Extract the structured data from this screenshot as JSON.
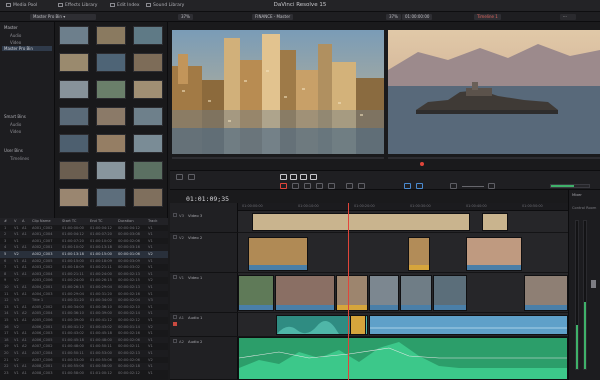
{
  "window": {
    "title": "DaVinci Resolve 15"
  },
  "top_tabs": [
    {
      "label": "Media Pool",
      "icon": "media-pool-icon"
    },
    {
      "label": "Effects Library",
      "icon": "effects-icon"
    },
    {
      "label": "Edit Index",
      "icon": "list-icon"
    },
    {
      "label": "Sound Library",
      "icon": "sound-library-icon"
    }
  ],
  "subbar": {
    "bin_select": "Master Pro Bin",
    "zoom_left": "37%",
    "source_name": "FINANCE - Master",
    "zoom_right": "37%",
    "timecode_display": "01:00:00:00",
    "timeline_name": "Timeline 1"
  },
  "bins": {
    "root": "Master",
    "items": [
      "Audio",
      "Master Pro Bin",
      "Video"
    ],
    "selected": "Master Pro Bin",
    "smart_bins_header": "Smart Bins",
    "smart_bins": [
      "Audio",
      "Video"
    ],
    "user_bins_header": "User Bins",
    "user_bins": [
      "Timelines"
    ]
  },
  "clip_list": {
    "columns": [
      "#",
      "V",
      "A",
      "Clip Name",
      "Start TC",
      "End TC",
      "Duration",
      "Track"
    ],
    "rows": [
      [
        "1",
        "V1",
        "A1",
        "A001_C002",
        "01:00:00:00",
        "01:00:04:12",
        "00:00:04:12",
        "V1"
      ],
      [
        "2",
        "V1",
        "A1",
        "A001_C004",
        "01:00:04:12",
        "01:00:07:20",
        "00:00:03:08",
        "V1"
      ],
      [
        "3",
        "V1",
        "",
        "A001_C007",
        "01:00:07:20",
        "01:00:10:02",
        "00:00:02:06",
        "V1"
      ],
      [
        "4",
        "V1",
        "A1",
        "A002_C001",
        "01:00:10:02",
        "01:00:13:18",
        "00:00:03:16",
        "V1"
      ],
      [
        "5",
        "V2",
        "",
        "A002_C003",
        "01:00:13:18",
        "01:00:15:00",
        "00:00:01:06",
        "V2"
      ],
      [
        "6",
        "V1",
        "A1",
        "A002_C005",
        "01:00:15:00",
        "01:00:18:09",
        "00:00:03:09",
        "V1"
      ],
      [
        "7",
        "V1",
        "A1",
        "A003_C002",
        "01:00:18:09",
        "01:00:21:11",
        "00:00:03:02",
        "V1"
      ],
      [
        "8",
        "V1",
        "A1",
        "A003_C004",
        "01:00:21:11",
        "01:00:24:00",
        "00:00:02:13",
        "V1"
      ],
      [
        "9",
        "V2",
        "",
        "A003_C006",
        "01:00:24:00",
        "01:00:26:15",
        "00:00:02:15",
        "V2"
      ],
      [
        "10",
        "V1",
        "A1",
        "A004_C001",
        "01:00:26:15",
        "01:00:29:04",
        "00:00:02:13",
        "V1"
      ],
      [
        "11",
        "V1",
        "A1",
        "A004_C003",
        "01:00:29:04",
        "01:00:31:20",
        "00:00:02:16",
        "V1"
      ],
      [
        "12",
        "V3",
        "",
        "Title 1",
        "01:00:31:20",
        "01:00:34:00",
        "00:00:02:04",
        "V3"
      ],
      [
        "13",
        "V1",
        "A1",
        "A005_C002",
        "01:00:34:00",
        "01:00:36:10",
        "00:00:02:10",
        "V1"
      ],
      [
        "14",
        "V1",
        "A2",
        "A005_C004",
        "01:00:36:10",
        "01:00:39:00",
        "00:00:02:14",
        "V1"
      ],
      [
        "15",
        "V1",
        "A1",
        "A005_C006",
        "01:00:39:00",
        "01:00:41:12",
        "00:00:02:12",
        "V1"
      ],
      [
        "16",
        "V2",
        "",
        "A006_C001",
        "01:00:41:12",
        "01:00:43:02",
        "00:00:01:14",
        "V2"
      ],
      [
        "17",
        "V1",
        "A1",
        "A006_C003",
        "01:00:43:02",
        "01:00:45:18",
        "00:00:02:16",
        "V1"
      ],
      [
        "18",
        "V1",
        "A1",
        "A006_C005",
        "01:00:45:18",
        "01:00:48:00",
        "00:00:02:06",
        "V1"
      ],
      [
        "19",
        "V1",
        "A2",
        "A007_C002",
        "01:00:48:00",
        "01:00:50:11",
        "00:00:02:11",
        "V1"
      ],
      [
        "20",
        "V1",
        "A1",
        "A007_C004",
        "01:00:50:11",
        "01:00:53:00",
        "00:00:02:13",
        "V1"
      ],
      [
        "21",
        "V2",
        "",
        "A007_C006",
        "01:00:53:00",
        "01:00:55:06",
        "00:00:02:06",
        "V2"
      ],
      [
        "22",
        "V1",
        "A1",
        "A008_C001",
        "01:00:55:06",
        "01:00:58:00",
        "00:00:02:18",
        "V1"
      ],
      [
        "23",
        "V1",
        "A1",
        "A008_C003",
        "01:00:58:00",
        "01:01:00:12",
        "00:00:02:12",
        "V1"
      ]
    ],
    "selected_row": 4
  },
  "timeline": {
    "timecode": "01:01:09;35",
    "ruler_labels": [
      "01:00:00:00",
      "01:00:10:00",
      "01:00:20:00",
      "01:00:30:00",
      "01:00:40:00",
      "01:00:50:00"
    ],
    "tracks": [
      {
        "id": "V3",
        "name": "Video 3"
      },
      {
        "id": "V2",
        "name": "Video 2"
      },
      {
        "id": "V1",
        "name": "Video 1"
      },
      {
        "id": "A1",
        "name": "Audio 1"
      },
      {
        "id": "A2",
        "name": "Audio 2"
      }
    ]
  },
  "mixer": {
    "label": "Mixer",
    "master_label": "Control Room"
  },
  "colors": {
    "clip_blue": "#4a7fa8",
    "title_clip": "#c9b48e",
    "audio_teal": "#2f8c82",
    "audio_green": "#2c9e6a",
    "playhead": "#e0453a"
  }
}
